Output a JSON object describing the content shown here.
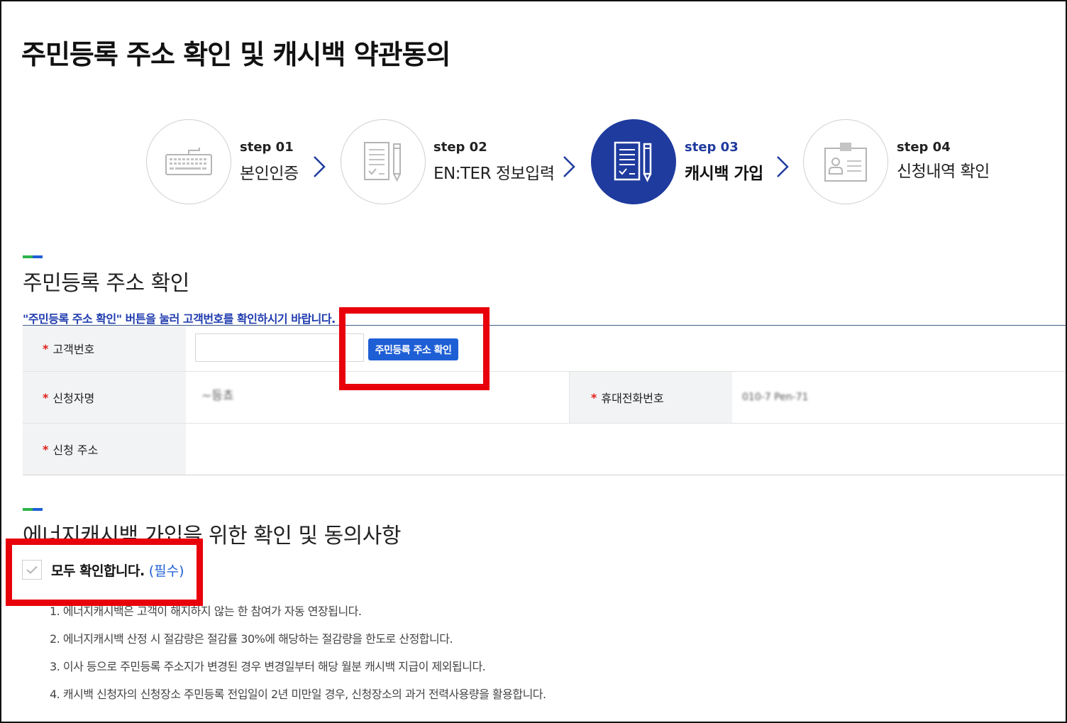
{
  "page": {
    "title": "주민등록 주소 확인 및 캐시백 약관동의"
  },
  "steps": [
    {
      "num": "step 01",
      "label": "본인인증",
      "icon": "keyboard-icon",
      "active": false
    },
    {
      "num": "step 02",
      "label": "EN:TER 정보입력",
      "icon": "document-pencil-icon",
      "active": false
    },
    {
      "num": "step 03",
      "label": "캐시백 가입",
      "icon": "document-pencil-icon",
      "active": true
    },
    {
      "num": "step 04",
      "label": "신청내역 확인",
      "icon": "id-card-icon",
      "active": false
    }
  ],
  "address_section": {
    "title": "주민등록 주소 확인",
    "notice": "\"주민등록 주소 확인\" 버튼을 눌러 고객번호를 확인하시기 바랍니다.",
    "customer_no_label": "고객번호",
    "customer_no_value": "",
    "confirm_button": "주민등록 주소 확인",
    "applicant_label": "신청자명",
    "applicant_value": "~등쵸",
    "phone_label": "휴대전화번호",
    "phone_value": "010-7 Pen-71",
    "address_label": "신청 주소",
    "address_value": ""
  },
  "consent_section": {
    "title": "에너지캐시백 가입을 위한 확인 및 동의사항",
    "agree_all": "모두 확인합니다.",
    "required": "(필수)",
    "terms": [
      "1. 에너지캐시백은 고객이 해지하지 않는 한 참여가 자동 연장됩니다.",
      "2. 에너지캐시백 산정 시 절감량은 절감률 30%에 해당하는 절감량을 한도로 산정합니다.",
      "3. 이사 등으로 주민등록 주소지가 변경된 경우 변경일부터 해당 월분 캐시백 지급이 제외됩니다.",
      "4. 캐시백 신청자의 신청장소 주민등록 전입일이 2년 미만일 경우, 신청장소의 과거 전력사용량을 활용합니다."
    ]
  },
  "colors": {
    "accent": "#1f3b9e",
    "button": "#1f5fd6",
    "highlight": "#e8000b",
    "required_star": "#e0201b"
  }
}
